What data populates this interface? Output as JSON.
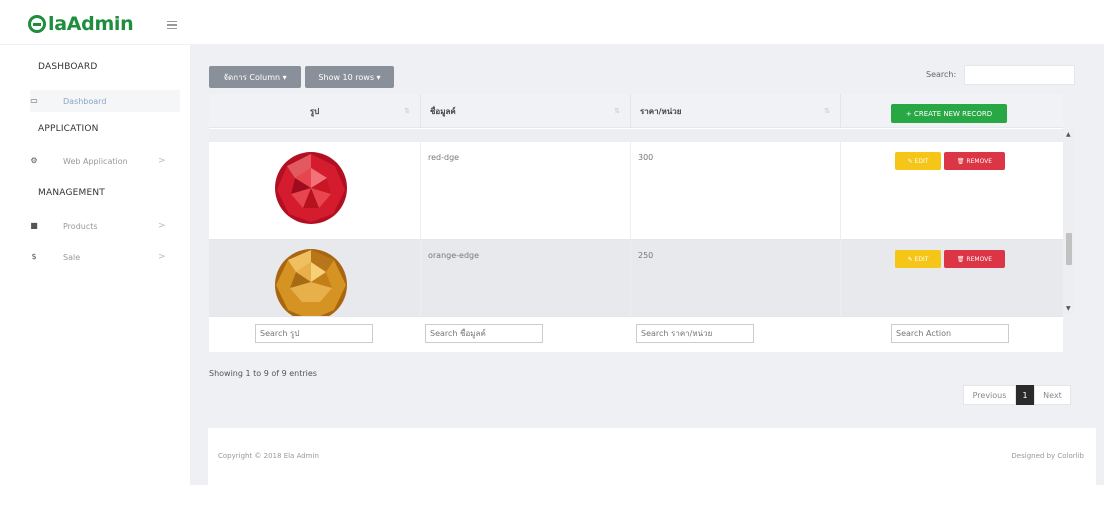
{
  "brand": {
    "logo_letter": "E",
    "name": "laAdmin",
    "color": "#1e8e3e"
  },
  "sidebar": {
    "sections": [
      {
        "title": "DASHBOARD"
      },
      {
        "title": "APPLICATION"
      },
      {
        "title": "MANAGEMENT"
      }
    ],
    "items": [
      {
        "label": "Dashboard",
        "icon": "dashboard-icon",
        "glyph": "▭"
      },
      {
        "label": "Web Application",
        "icon": "cogs-icon",
        "glyph": "⚙",
        "arrow": ">"
      },
      {
        "label": "Products",
        "icon": "box-icon",
        "glyph": "■",
        "arrow": ">"
      },
      {
        "label": "Sale",
        "icon": "dollar-icon",
        "glyph": "$",
        "arrow": ">"
      }
    ]
  },
  "toolbar": {
    "manage_columns_label": "จัดการ Column ▾",
    "show_rows_label": "Show 10 rows ▾",
    "search_label": "Search:",
    "search_value": ""
  },
  "table": {
    "columns": [
      {
        "label": "รูป",
        "sort": "⇅"
      },
      {
        "label": "ชื่อมูลค์",
        "sort": "⇅"
      },
      {
        "label": "ราคา/หน่วย",
        "sort": "⇅"
      }
    ],
    "create_label": "+ CREATE NEW RECORD",
    "rows": [
      {
        "name": "red-dge",
        "price": "300",
        "edit_label": "✎ EDIT",
        "remove_label": "🗑 REMOVE",
        "gem_color": "#c8102e"
      },
      {
        "name": "orange-edge",
        "price": "250",
        "edit_label": "✎ EDIT",
        "remove_label": "🗑 REMOVE",
        "gem_color": "#d4a017"
      }
    ],
    "footer_placeholders": [
      "Search รูป",
      "Search ชื่อมูลค์",
      "Search ราคา/หน่วย",
      "Search Action"
    ]
  },
  "info": "Showing 1 to 9 of 9 entries",
  "pagination": {
    "previous": "Previous",
    "page": "1",
    "next": "Next"
  },
  "footer": {
    "copyright": "Copyright © 2018 Ela Admin",
    "designed": "Designed by Colorlib"
  },
  "scroll": {
    "up_glyph": "▲",
    "down_glyph": "▼"
  }
}
